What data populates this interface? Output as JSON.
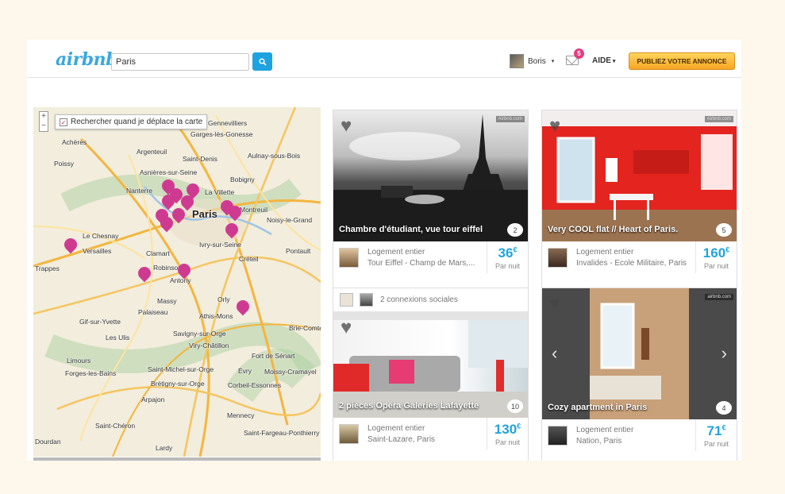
{
  "header": {
    "logo": "airbnb",
    "search_value": "Paris",
    "user_name": "Boris",
    "messages_count": "5",
    "help_label": "AIDE",
    "publish_label": "PUBLIEZ VOTRE ANNONCE",
    "caret": "▾"
  },
  "map": {
    "checkbox_label": "Rechercher quand je déplace la carte",
    "checkbox_mark": "✓",
    "zoom_in": "+",
    "zoom_out": "−",
    "labels": [
      "Gennevilliers",
      "Garges-lès-Gonesse",
      "Achères",
      "Argenteuil",
      "Saint-Denis",
      "Aulnay-sous-Bois",
      "Poissy",
      "Asnières-sur-Seine",
      "Bobigny",
      "Nanterre",
      "La Villette",
      "Paris",
      "Montreuil",
      "Noisy-le-Grand",
      "Le Chesnay",
      "Versailles",
      "Clamart",
      "Ivry-sur-Seine",
      "Créteil",
      "Pontault",
      "Trappes",
      "Robinson",
      "Antony",
      "Massy",
      "Orly",
      "Palaiseau",
      "Gif-sur-Yvette",
      "Savigny-sur-Orge",
      "Athis-Mons",
      "Brie-Comte",
      "Les Ulis",
      "Viry-Châtillon",
      "Limours",
      "Forges-les-Bains",
      "Saint-Michel-sur-Orge",
      "Évry",
      "Moissy-Cramayel",
      "Brétigny-sur-Orge",
      "Corbeil-Essonnes",
      "Arpajon",
      "Mennecy",
      "Saint-Chéron",
      "Dourdan",
      "Lardy",
      "Saint-Fargeau-Ponthierry",
      "Fort de Sénart"
    ]
  },
  "listings": [
    {
      "title": "Chambre d'étudiant, vue tour eiffel",
      "type": "Logement entier",
      "location": "Tour Eiffel - Champ de Mars,...",
      "price": "36",
      "currency": "€",
      "per": "Par nuit",
      "reviews": "2",
      "tag": "Airbnb.com"
    },
    {
      "title": "Very COOL flat // Heart of Paris.",
      "type": "Logement entier",
      "location": "Invalides - Ecole Militaire, Paris",
      "price": "160",
      "currency": "€",
      "per": "Par nuit",
      "reviews": "5",
      "tag": "Airbnb.com"
    },
    {
      "title": "2 pièces Opéra Galeries Lafayette",
      "type": "Logement entier",
      "location": "Saint-Lazare, Paris",
      "price": "130",
      "currency": "€",
      "per": "Par nuit",
      "reviews": "10",
      "social": "2 connexions sociales"
    },
    {
      "title": "Cozy apartment in Paris",
      "type": "Logement entier",
      "location": "Nation, Paris",
      "price": "71",
      "currency": "€",
      "per": "Par nuit",
      "reviews": "4",
      "tag": "airbnb.com",
      "prev": "‹",
      "next": "›"
    }
  ],
  "colors": {
    "accent": "#1fa3e0",
    "pin": "#cf3a91",
    "cta": "#f6a623"
  }
}
